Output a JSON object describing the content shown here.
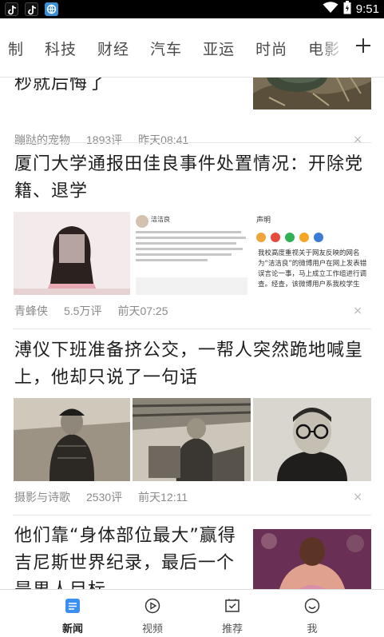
{
  "status_bar": {
    "time": "9:51",
    "icons": [
      "tiktok-icon",
      "tiktok-icon",
      "browser-app-icon",
      "wifi-icon",
      "battery-icon"
    ]
  },
  "channel_tabs": [
    {
      "label": "制"
    },
    {
      "label": "科技"
    },
    {
      "label": "财经"
    },
    {
      "label": "汽车"
    },
    {
      "label": "亚运"
    },
    {
      "label": "时尚"
    },
    {
      "label": "电影"
    }
  ],
  "add_channel_icon": "plus-icon",
  "articles": [
    {
      "title": "秒就后悔了",
      "source": "蹦跶的宠物",
      "comments": "1893评",
      "time": "昨天08:41"
    },
    {
      "title": "厦门大学通报田佳良事件处置情况：开除党籍、退学",
      "source": "青蜂侠",
      "comments": "5.5万评",
      "time": "前天07:25",
      "thumb_text": {
        "weibo_name": "洁洁良",
        "statement_title": "声明",
        "statement_body": "我校高度重视关于网友反映的网名为“洁洁良”的微博用户在网上发表错误言论一事，马上成立工作组进行调查。经查，该微博用户系我校学生"
      }
    },
    {
      "title": "溥仪下班准备挤公交，一帮人突然跪地喊皇上，他却只说了一句话",
      "source": "摄影与诗歌",
      "comments": "2530评",
      "time": "前天12:11"
    },
    {
      "title": "他们靠“身体部位最大”赢得吉尼斯世界纪录，最后一个是男人目标"
    }
  ],
  "dismiss_label": "×",
  "bottom_nav": [
    {
      "label": "新闻",
      "icon": "news-icon",
      "active": true
    },
    {
      "label": "视频",
      "icon": "video-play-icon",
      "active": false
    },
    {
      "label": "推荐",
      "icon": "recommend-icon",
      "active": false
    },
    {
      "label": "我",
      "icon": "profile-smile-icon",
      "active": false
    }
  ],
  "colors": {
    "accent": "#3b8ff0",
    "meta_text": "#8a8a8a",
    "divider": "#e6e6e6"
  }
}
